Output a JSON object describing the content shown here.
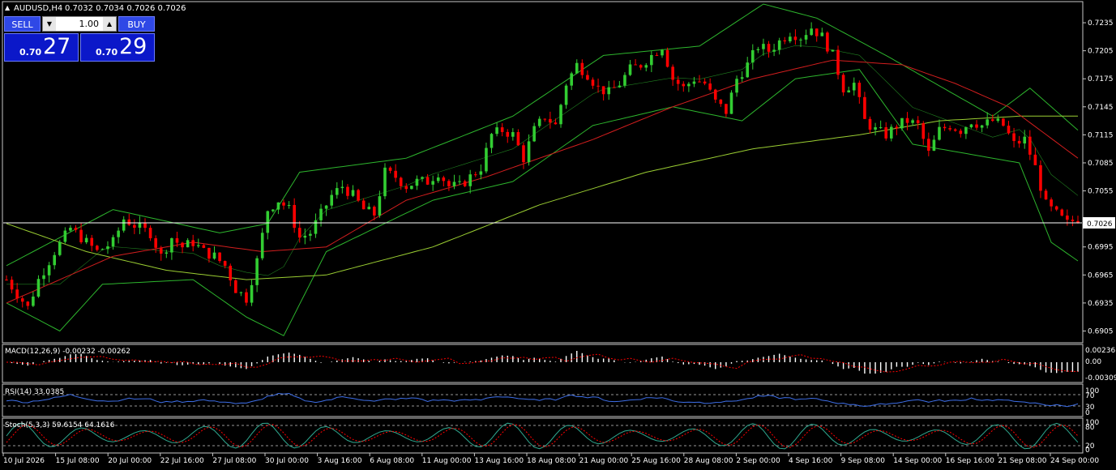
{
  "header": {
    "symbol_label": "AUDUSD,H4",
    "ohlc_text": "0.7032 0.7034 0.7026 0.7026",
    "triangle_icon": "triangle-up-icon"
  },
  "trade_panel": {
    "sell_label": "SELL",
    "buy_label": "BUY",
    "lot_value": "1.00",
    "sell_quote": {
      "small": "0.70",
      "big": "27"
    },
    "buy_quote": {
      "small": "0.70",
      "big": "29"
    },
    "quote_color": "#0b18c9",
    "button_color": "#2f48e6"
  },
  "price_axis": {
    "labels": [
      "0.7235",
      "0.7205",
      "0.7175",
      "0.7145",
      "0.7115",
      "0.7085",
      "0.7055",
      "0.6995",
      "0.6965",
      "0.6935",
      "0.6905"
    ],
    "current_price": "0.7026"
  },
  "time_axis": {
    "labels": [
      "10 Jul 2026",
      "15 Jul 08:00",
      "20 Jul 00:00",
      "22 Jul 16:00",
      "27 Jul 08:00",
      "30 Jul 00:00",
      "3 Aug 16:00",
      "6 Aug 08:00",
      "11 Aug 00:00",
      "13 Aug 16:00",
      "18 Aug 08:00",
      "21 Aug 00:00",
      "25 Aug 16:00",
      "28 Aug 08:00",
      "2 Sep 00:00",
      "4 Sep 16:00",
      "9 Sep 08:00",
      "14 Sep 00:00",
      "16 Sep 16:00",
      "21 Sep 08:00",
      "24 Sep 00:00"
    ]
  },
  "indicators": {
    "macd": {
      "label": "MACD(12,26,9) -0.00232 -0.00262",
      "axis": [
        "0.00236",
        "0.00",
        "-0.00309"
      ]
    },
    "rsi": {
      "label": "RSI(14) 33.0385",
      "axis": [
        "100",
        "70",
        "30",
        "0"
      ]
    },
    "stoch": {
      "label": "Stoch(5,3,3) 59.6154 64.1616",
      "axis": [
        "100",
        "80",
        "20",
        "0"
      ]
    }
  },
  "colors": {
    "bull": "#32cd32",
    "bear": "#ff0000",
    "bands": "#2db52d",
    "ma_fast": "#d21e1e",
    "ma_slow": "#9acd32",
    "rsi_line": "#3d6ee8",
    "grid": "#c8c8c8"
  },
  "chart_data": {
    "type": "candlestick",
    "symbol": "AUDUSD",
    "timeframe": "H4",
    "ylim": [
      0.6895,
      0.7255
    ],
    "current_price": 0.7026,
    "close_path": [
      [
        0,
        0.696
      ],
      [
        4,
        0.693
      ],
      [
        6,
        0.696
      ],
      [
        9,
        0.699
      ],
      [
        12,
        0.7015
      ],
      [
        14,
        0.7005
      ],
      [
        17,
        0.699
      ],
      [
        20,
        0.7
      ],
      [
        22,
        0.7025
      ],
      [
        25,
        0.7015
      ],
      [
        27,
        0.701
      ],
      [
        29,
        0.6985
      ],
      [
        31,
        0.7005
      ],
      [
        33,
        0.6995
      ],
      [
        35,
        0.7
      ],
      [
        37,
        0.699
      ],
      [
        39,
        0.6985
      ],
      [
        41,
        0.6975
      ],
      [
        43,
        0.695
      ],
      [
        45,
        0.694
      ],
      [
        47,
        0.698
      ],
      [
        49,
        0.7035
      ],
      [
        51,
        0.7045
      ],
      [
        53,
        0.7035
      ],
      [
        55,
        0.7005
      ],
      [
        57,
        0.701
      ],
      [
        59,
        0.703
      ],
      [
        61,
        0.705
      ],
      [
        63,
        0.706
      ],
      [
        65,
        0.705
      ],
      [
        67,
        0.7035
      ],
      [
        69,
        0.703
      ],
      [
        71,
        0.7075
      ],
      [
        73,
        0.707
      ],
      [
        75,
        0.706
      ],
      [
        77,
        0.7065
      ],
      [
        79,
        0.7065
      ],
      [
        81,
        0.7075
      ],
      [
        83,
        0.706
      ],
      [
        85,
        0.706
      ],
      [
        87,
        0.707
      ],
      [
        89,
        0.708
      ],
      [
        91,
        0.7115
      ],
      [
        93,
        0.712
      ],
      [
        95,
        0.7115
      ],
      [
        97,
        0.709
      ],
      [
        99,
        0.712
      ],
      [
        101,
        0.7135
      ],
      [
        103,
        0.7125
      ],
      [
        105,
        0.717
      ],
      [
        107,
        0.719
      ],
      [
        109,
        0.718
      ],
      [
        111,
        0.7165
      ],
      [
        113,
        0.716
      ],
      [
        115,
        0.717
      ],
      [
        117,
        0.7185
      ],
      [
        119,
        0.719
      ],
      [
        121,
        0.72
      ],
      [
        123,
        0.721
      ],
      [
        125,
        0.7175
      ],
      [
        127,
        0.7165
      ],
      [
        129,
        0.7175
      ],
      [
        131,
        0.717
      ],
      [
        133,
        0.715
      ],
      [
        135,
        0.714
      ],
      [
        137,
        0.7175
      ],
      [
        139,
        0.719
      ],
      [
        141,
        0.721
      ],
      [
        143,
        0.7205
      ],
      [
        145,
        0.7215
      ],
      [
        147,
        0.7225
      ],
      [
        149,
        0.722
      ],
      [
        151,
        0.723
      ],
      [
        153,
        0.722
      ],
      [
        155,
        0.72
      ],
      [
        157,
        0.7165
      ],
      [
        159,
        0.717
      ],
      [
        161,
        0.713
      ],
      [
        163,
        0.712
      ],
      [
        165,
        0.7115
      ],
      [
        167,
        0.7125
      ],
      [
        169,
        0.713
      ],
      [
        171,
        0.7125
      ],
      [
        173,
        0.7095
      ],
      [
        175,
        0.712
      ],
      [
        177,
        0.7125
      ],
      [
        179,
        0.712
      ],
      [
        181,
        0.713
      ],
      [
        183,
        0.7125
      ],
      [
        185,
        0.713
      ],
      [
        187,
        0.7125
      ],
      [
        189,
        0.7105
      ],
      [
        191,
        0.711
      ],
      [
        193,
        0.708
      ],
      [
        195,
        0.704
      ],
      [
        197,
        0.703
      ],
      [
        199,
        0.702
      ],
      [
        201,
        0.7026
      ]
    ],
    "bollinger_upper": [
      [
        0,
        0.6975
      ],
      [
        20,
        0.7035
      ],
      [
        40,
        0.701
      ],
      [
        49,
        0.702
      ],
      [
        55,
        0.7075
      ],
      [
        75,
        0.709
      ],
      [
        95,
        0.7135
      ],
      [
        112,
        0.72
      ],
      [
        130,
        0.721
      ],
      [
        142,
        0.7255
      ],
      [
        152,
        0.724
      ],
      [
        165,
        0.72
      ],
      [
        185,
        0.7135
      ],
      [
        192,
        0.7165
      ],
      [
        201,
        0.712
      ]
    ],
    "bollinger_lower": [
      [
        0,
        0.6935
      ],
      [
        10,
        0.6905
      ],
      [
        18,
        0.6955
      ],
      [
        35,
        0.696
      ],
      [
        45,
        0.692
      ],
      [
        52,
        0.69
      ],
      [
        60,
        0.699
      ],
      [
        80,
        0.7045
      ],
      [
        95,
        0.7065
      ],
      [
        110,
        0.7125
      ],
      [
        125,
        0.7145
      ],
      [
        138,
        0.713
      ],
      [
        148,
        0.7175
      ],
      [
        160,
        0.7185
      ],
      [
        170,
        0.7105
      ],
      [
        180,
        0.7095
      ],
      [
        190,
        0.7085
      ],
      [
        196,
        0.7
      ],
      [
        201,
        0.698
      ]
    ],
    "ma_fast": [
      [
        0,
        0.6935
      ],
      [
        20,
        0.6985
      ],
      [
        35,
        0.7
      ],
      [
        48,
        0.699
      ],
      [
        60,
        0.6995
      ],
      [
        75,
        0.7045
      ],
      [
        90,
        0.707
      ],
      [
        110,
        0.711
      ],
      [
        125,
        0.7145
      ],
      [
        140,
        0.7175
      ],
      [
        155,
        0.7195
      ],
      [
        168,
        0.719
      ],
      [
        178,
        0.717
      ],
      [
        188,
        0.7145
      ],
      [
        201,
        0.709
      ]
    ],
    "ma_slow": [
      [
        0,
        0.702
      ],
      [
        15,
        0.699
      ],
      [
        30,
        0.697
      ],
      [
        45,
        0.696
      ],
      [
        60,
        0.6965
      ],
      [
        80,
        0.6995
      ],
      [
        100,
        0.704
      ],
      [
        120,
        0.7075
      ],
      [
        140,
        0.71
      ],
      [
        160,
        0.7115
      ],
      [
        175,
        0.713
      ],
      [
        190,
        0.7135
      ],
      [
        201,
        0.7135
      ]
    ],
    "macd_value": -0.00232,
    "macd_signal": -0.00262,
    "rsi_value": 33.0385,
    "stoch_k": 59.6154,
    "stoch_d": 64.1616
  }
}
